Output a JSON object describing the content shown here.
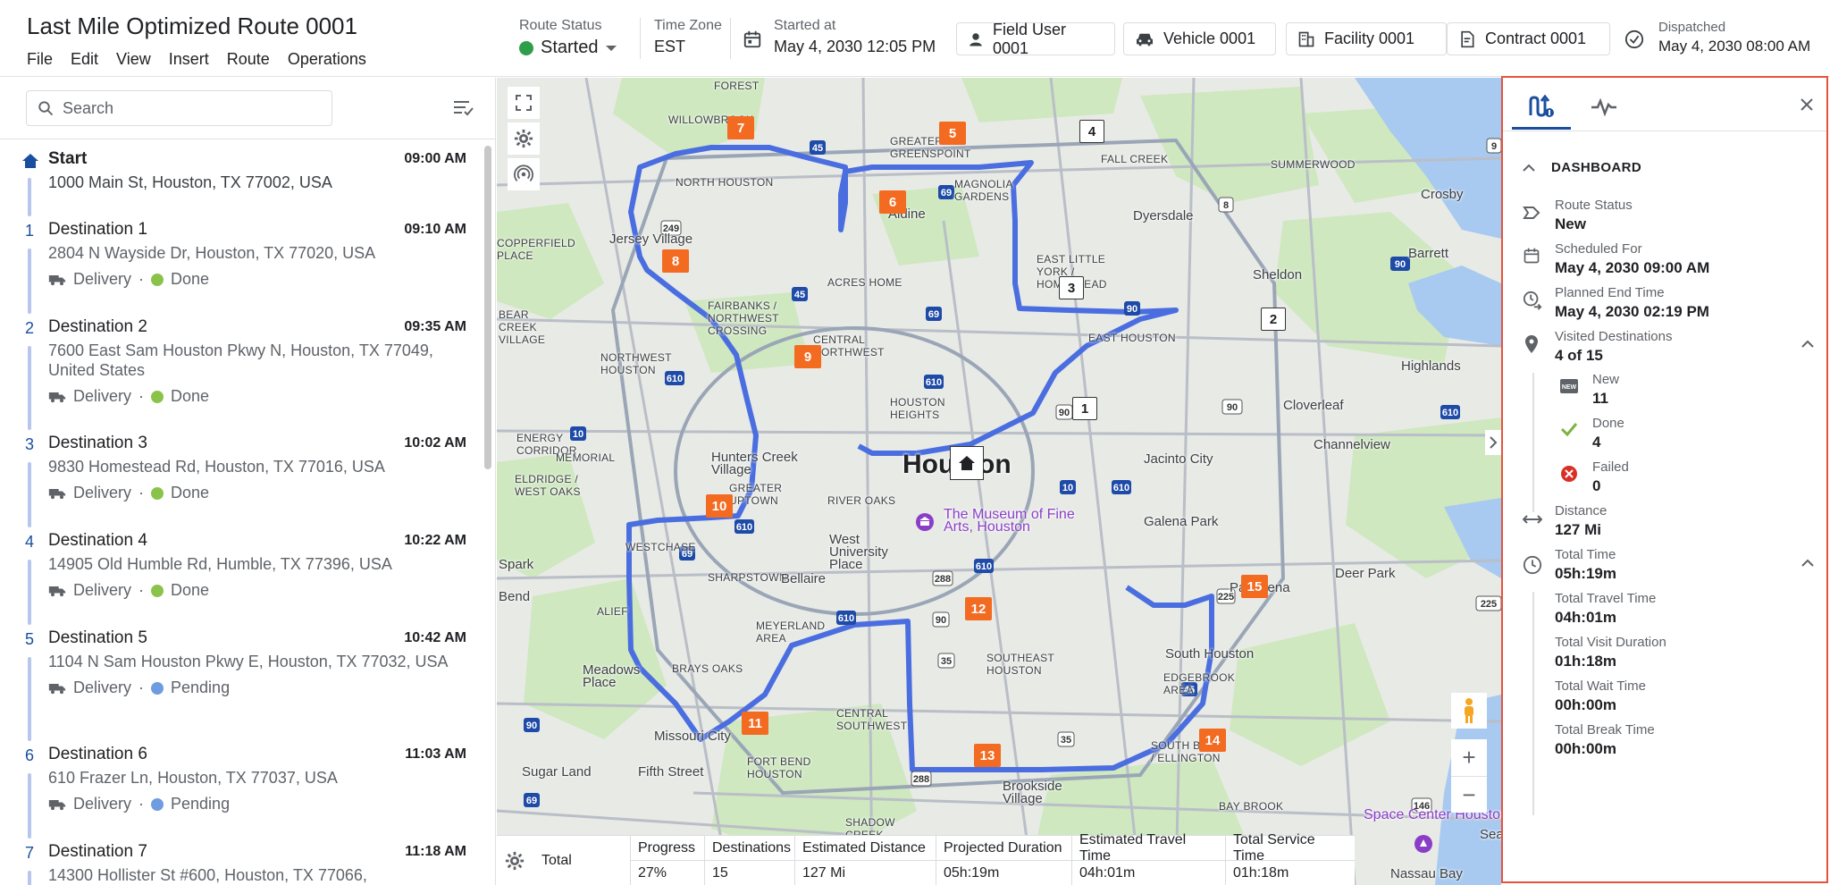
{
  "header": {
    "title": "Last Mile Optimized Route 0001",
    "menu": [
      "File",
      "Edit",
      "View",
      "Insert",
      "Route",
      "Operations"
    ],
    "route_status_label": "Route Status",
    "route_status_value": "Started",
    "timezone_label": "Time Zone",
    "timezone_value": "EST",
    "started_label": "Started at",
    "started_value": "May 4, 2030 12:05 PM",
    "field_user": "Field User 0001",
    "vehicle": "Vehicle 0001",
    "facility": "Facility 0001",
    "contract": "Contract 0001",
    "dispatched_label": "Dispatched",
    "dispatched_value": "May 4, 2030 08:00 AM",
    "status_color": "#2e9e4a"
  },
  "left": {
    "search_placeholder": "Search",
    "stops": [
      {
        "num": "",
        "name": "Start",
        "time": "09:00 AM",
        "address": "1000 Main St, Houston, TX 77002, USA",
        "type": "",
        "status": ""
      },
      {
        "num": "1",
        "name": "Destination 1",
        "time": "09:10 AM",
        "address": "2804 N Wayside Dr, Houston, TX 77020, USA",
        "type": "Delivery",
        "status": "Done"
      },
      {
        "num": "2",
        "name": "Destination 2",
        "time": "09:35 AM",
        "address": "7600 East Sam Houston Pkwy N, Houston, TX 77049, United States",
        "type": "Delivery",
        "status": "Done"
      },
      {
        "num": "3",
        "name": "Destination 3",
        "time": "10:02 AM",
        "address": "9830 Homestead Rd, Houston, TX 77016, USA",
        "type": "Delivery",
        "status": "Done"
      },
      {
        "num": "4",
        "name": "Destination 4",
        "time": "10:22 AM",
        "address": "14905 Old Humble Rd, Humble, TX 77396, USA",
        "type": "Delivery",
        "status": "Done"
      },
      {
        "num": "5",
        "name": "Destination 5",
        "time": "10:42 AM",
        "address": "1104 N Sam Houston Pkwy E, Houston, TX 77032, USA",
        "type": "Delivery",
        "status": "Pending"
      },
      {
        "num": "6",
        "name": "Destination 6",
        "time": "11:03 AM",
        "address": "610 Frazer Ln, Houston, TX 77037, USA",
        "type": "Delivery",
        "status": "Pending"
      },
      {
        "num": "7",
        "name": "Destination 7",
        "time": "11:18 AM",
        "address": "14300 Hollister St #600, Houston, TX 77066,",
        "type": "",
        "status": ""
      }
    ],
    "status_colors": {
      "Done": "#8bc34a",
      "Pending": "#6f9be0"
    }
  },
  "map": {
    "city": "Houston",
    "poi": "The Museum of Fine Arts, Houston",
    "space_center": "Space Center Houston",
    "labels": [
      {
        "t": "FOREST",
        "c": ""
      },
      {
        "t": "WILLOWBROOK",
        "c": ""
      },
      {
        "t": "GREATER GREENSPOINT",
        "c": ""
      },
      {
        "t": "FALL CREEK",
        "c": ""
      },
      {
        "t": "SUMMERWOOD",
        "c": ""
      },
      {
        "t": "NORTH HOUSTON",
        "c": ""
      },
      {
        "t": "MAGNOLIA GARDENS",
        "c": ""
      },
      {
        "t": "Aldine",
        "c": "mid"
      },
      {
        "t": "Dyersdale",
        "c": "mid"
      },
      {
        "t": "Crosby",
        "c": "mid"
      },
      {
        "t": "COPPERFIELD PLACE",
        "c": ""
      },
      {
        "t": "Jersey Village",
        "c": "mid"
      },
      {
        "t": "ACRES HOME",
        "c": ""
      },
      {
        "t": "EAST LITTLE YORK / HOMESTEAD",
        "c": ""
      },
      {
        "t": "Barrett",
        "c": "mid"
      },
      {
        "t": "Sheldon",
        "c": "mid"
      },
      {
        "t": "BEAR CREEK VILLAGE",
        "c": ""
      },
      {
        "t": "FAIRBANKS / NORTHWEST CROSSING",
        "c": ""
      },
      {
        "t": "CENTRAL NORTHWEST",
        "c": ""
      },
      {
        "t": "EAST HOUSTON",
        "c": ""
      },
      {
        "t": "Highlands",
        "c": "mid"
      },
      {
        "t": "NORTHWEST HOUSTON",
        "c": ""
      },
      {
        "t": "HOUSTON HEIGHTS",
        "c": ""
      },
      {
        "t": "Cloverleaf",
        "c": "mid"
      },
      {
        "t": "ENERGY CORRIDOR",
        "c": ""
      },
      {
        "t": "MEMORIAL",
        "c": ""
      },
      {
        "t": "Hunters Creek Village",
        "c": "mid"
      },
      {
        "t": "Channelview",
        "c": "mid"
      },
      {
        "t": "ELDRIDGE / WEST OAKS",
        "c": ""
      },
      {
        "t": "GREATER UPTOWN",
        "c": ""
      },
      {
        "t": "RIVER OAKS",
        "c": ""
      },
      {
        "t": "Jacinto City",
        "c": "mid"
      },
      {
        "t": "Galena Park",
        "c": "mid"
      },
      {
        "t": "WESTCHASE",
        "c": ""
      },
      {
        "t": "West University Place",
        "c": "mid"
      },
      {
        "t": "SHARPSTOWN",
        "c": ""
      },
      {
        "t": "Bellaire",
        "c": "mid"
      },
      {
        "t": "Deer Park",
        "c": "mid"
      },
      {
        "t": "Bend",
        "c": "mid"
      },
      {
        "t": "ALIEF",
        "c": ""
      },
      {
        "t": "Pasadena",
        "c": "mid"
      },
      {
        "t": "MEYERLAND AREA",
        "c": ""
      },
      {
        "t": "SOUTHEAST HOUSTON",
        "c": ""
      },
      {
        "t": "South Houston",
        "c": "mid"
      },
      {
        "t": "Meadows Place",
        "c": "mid"
      },
      {
        "t": "BRAYS OAKS",
        "c": ""
      },
      {
        "t": "EDGEBROOK AREA",
        "c": ""
      },
      {
        "t": "CENTRAL SOUTHWEST",
        "c": ""
      },
      {
        "t": "Missouri City",
        "c": "mid"
      },
      {
        "t": "FORT BEND HOUSTON",
        "c": ""
      },
      {
        "t": "SOUTH BELT / ELLINGTON",
        "c": ""
      },
      {
        "t": "Sugar Land",
        "c": "mid"
      },
      {
        "t": "Fifth Street",
        "c": "mid"
      },
      {
        "t": "Brookside Village",
        "c": "mid"
      },
      {
        "t": "SHADOW CREEK RANCH",
        "c": ""
      },
      {
        "t": "BAY BROOK",
        "c": ""
      },
      {
        "t": "Nassau Bay",
        "c": "mid"
      },
      {
        "t": "Seabrook",
        "c": "mid"
      },
      {
        "t": "Spark",
        "c": "mid"
      }
    ],
    "markers": [
      "1",
      "2",
      "3",
      "4",
      "5",
      "6",
      "7",
      "8",
      "9",
      "10",
      "11",
      "12",
      "13",
      "14",
      "15"
    ],
    "route_color": "#4a6ee0",
    "marker_color": "#f36a21"
  },
  "summary": {
    "total_label": "Total",
    "cols": [
      {
        "h": "Progress",
        "v": "27%"
      },
      {
        "h": "Destinations",
        "v": "15"
      },
      {
        "h": "Estimated Distance",
        "v": "127 Mi"
      },
      {
        "h": "Projected Duration",
        "v": "05h:19m"
      },
      {
        "h": "Estimated Travel Time",
        "v": "04h:01m"
      },
      {
        "h": "Total Service Time",
        "v": "01h:18m"
      }
    ]
  },
  "dashboard": {
    "title": "DASHBOARD",
    "route_status_l": "Route Status",
    "route_status_v": "New",
    "scheduled_l": "Scheduled For",
    "scheduled_v": "May 4, 2030 09:00 AM",
    "planned_end_l": "Planned End Time",
    "planned_end_v": "May 4, 2030 02:19 PM",
    "visited_l": "Visited Destinations",
    "visited_v": "4 of 15",
    "new_l": "New",
    "new_v": "11",
    "done_l": "Done",
    "done_v": "4",
    "failed_l": "Failed",
    "failed_v": "0",
    "distance_l": "Distance",
    "distance_v": "127 Mi",
    "total_time_l": "Total Time",
    "total_time_v": "05h:19m",
    "travel_l": "Total Travel Time",
    "travel_v": "04h:01m",
    "visit_l": "Total Visit Duration",
    "visit_v": "01h:18m",
    "wait_l": "Total Wait Time",
    "wait_v": "00h:00m",
    "break_l": "Total Break Time",
    "break_v": "00h:00m",
    "accent": "#1a4fa0",
    "border": "#e5533d"
  }
}
